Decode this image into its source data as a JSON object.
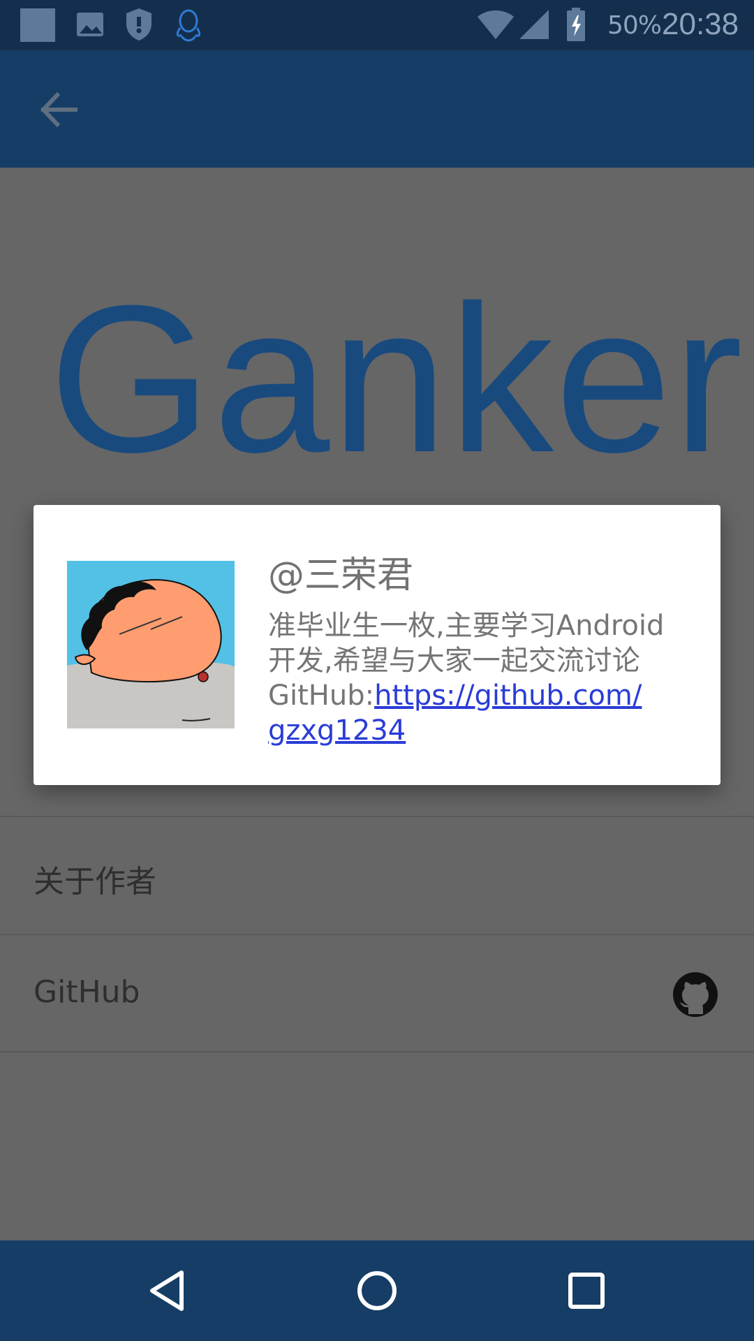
{
  "status_bar": {
    "battery_text": "50%",
    "time": "20:38",
    "icons": [
      "notification-square-icon",
      "image-icon",
      "shield-icon",
      "qq-icon",
      "wifi-icon",
      "signal-icon",
      "battery-icon"
    ]
  },
  "app_bar": {
    "back_icon": "arrow-back-icon"
  },
  "page": {
    "logo_text": "Ganker",
    "list_items": [
      {
        "label": "关于作者"
      },
      {
        "label": "GitHub",
        "icon": "github-icon"
      }
    ]
  },
  "dialog": {
    "name": "@三荣君",
    "bio_line1": "准毕业生一枚,主要学习Android",
    "bio_line2": "开发,希望与大家一起交流讨论",
    "github_prefix": "GitHub:",
    "github_link_part1": "https://github.com/",
    "github_link_part2": "gzxg1234",
    "avatar_icon": "cartoon-avatar"
  },
  "nav_bar": {
    "icons": [
      "nav-back-icon",
      "nav-home-icon",
      "nav-recent-icon"
    ]
  },
  "colors": {
    "status_bar": "#142f4d",
    "app_bar": "#163d65",
    "scrim_background": "#666666",
    "logo": "#184a7e",
    "link": "#2a3cd6"
  }
}
